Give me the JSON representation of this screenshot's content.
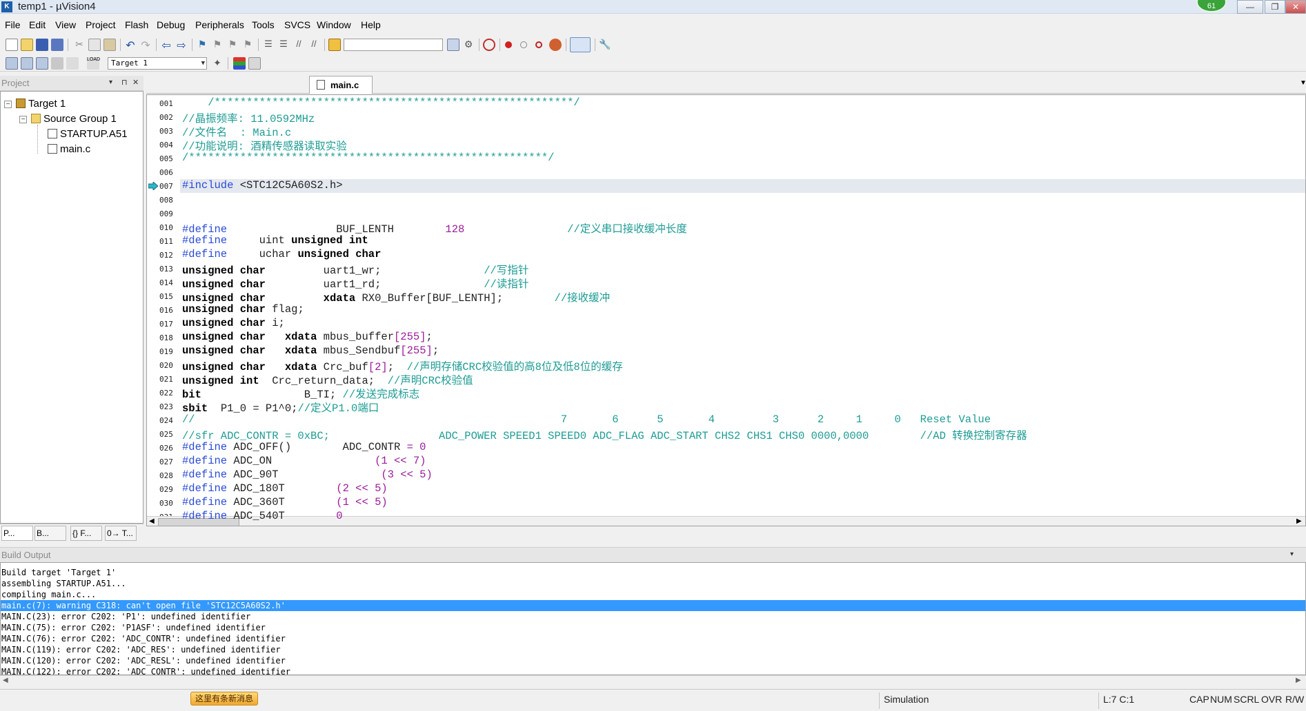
{
  "window": {
    "title": "temp1  - µVision4",
    "badge": "61",
    "controls": [
      "—",
      "❐",
      "✕"
    ]
  },
  "menu": [
    "File",
    "Edit",
    "View",
    "Project",
    "Flash",
    "Debug",
    "Peripherals",
    "Tools",
    "SVCS",
    "Window",
    "Help"
  ],
  "toolbar": {
    "target_combo": "Target 1",
    "find_combo": ""
  },
  "project_panel": {
    "title": "Project",
    "header_buttons": [
      "▾",
      "⊓",
      "✕"
    ],
    "tree": {
      "target": "Target 1",
      "group": "Source Group 1",
      "files": [
        "STARTUP.A51",
        "main.c"
      ]
    },
    "tabs": [
      "P...",
      "B...",
      "{} F...",
      "0→ T..."
    ]
  },
  "editor": {
    "tab": "main.c",
    "lines": [
      {
        "n": "001",
        "code": "    /********************************************************/"
      },
      {
        "n": "002",
        "code": "//晶振频率: 11.0592MHz"
      },
      {
        "n": "003",
        "code": "//文件名  : Main.c"
      },
      {
        "n": "004",
        "code": "//功能说明: 酒精传感器读取实验"
      },
      {
        "n": "005",
        "code": "/********************************************************/"
      },
      {
        "n": "006",
        "code": ""
      },
      {
        "n": "007",
        "code": "#include <STC12C5A60S2.h>"
      },
      {
        "n": "008",
        "code": ""
      },
      {
        "n": "009",
        "code": ""
      },
      {
        "n": "010",
        "code": "#define                 BUF_LENTH        128                //定义串口接收缓冲长度"
      },
      {
        "n": "011",
        "code": "#define     uint unsigned int"
      },
      {
        "n": "012",
        "code": "#define     uchar unsigned char"
      },
      {
        "n": "013",
        "code": "unsigned char         uart1_wr;                //写指针"
      },
      {
        "n": "014",
        "code": "unsigned char         uart1_rd;                //读指针"
      },
      {
        "n": "015",
        "code": "unsigned char         xdata RX0_Buffer[BUF_LENTH];        //接收缓冲"
      },
      {
        "n": "016",
        "code": "unsigned char flag;"
      },
      {
        "n": "017",
        "code": "unsigned char i;"
      },
      {
        "n": "018",
        "code": "unsigned char   xdata mbus_buffer[255];"
      },
      {
        "n": "019",
        "code": "unsigned char   xdata mbus_Sendbuf[255];"
      },
      {
        "n": "020",
        "code": "unsigned char   xdata Crc_buf[2];  //声明存储CRC校验值的高8位及低8位的缓存"
      },
      {
        "n": "021",
        "code": "unsigned int  Crc_return_data;  //声明CRC校验值"
      },
      {
        "n": "022",
        "code": "bit                B_TI; //发送完成标志"
      },
      {
        "n": "023",
        "code": "sbit  P1_0 = P1^0;//定义P1.0端口"
      },
      {
        "n": "024",
        "code": "//                                                         7       6      5       4         3      2     1     0   Reset Value"
      },
      {
        "n": "025",
        "code": "//sfr ADC_CONTR = 0xBC;                 ADC_POWER SPEED1 SPEED0 ADC_FLAG ADC_START CHS2 CHS1 CHS0 0000,0000        //AD 转换控制寄存器"
      },
      {
        "n": "026",
        "code": "#define ADC_OFF()        ADC_CONTR = 0"
      },
      {
        "n": "027",
        "code": "#define ADC_ON                (1 << 7)"
      },
      {
        "n": "028",
        "code": "#define ADC_90T                (3 << 5)"
      },
      {
        "n": "029",
        "code": "#define ADC_180T        (2 << 5)"
      },
      {
        "n": "030",
        "code": "#define ADC_360T        (1 << 5)"
      },
      {
        "n": "031",
        "code": "#define ADC_540T        0"
      }
    ]
  },
  "build_output": {
    "title": "Build Output",
    "lines": [
      "Build target 'Target 1'",
      "assembling STARTUP.A51...",
      "compiling main.c...",
      "main.c(7): warning C318: can't open file 'STC12C5A60S2.h'",
      "MAIN.C(23): error C202: 'P1': undefined identifier",
      "MAIN.C(75): error C202: 'P1ASF': undefined identifier",
      "MAIN.C(76): error C202: 'ADC_CONTR': undefined identifier",
      "MAIN.C(119): error C202: 'ADC_RES': undefined identifier",
      "MAIN.C(120): error C202: 'ADC_RESL': undefined identifier",
      "MAIN.C(122): error C202: 'ADC_CONTR': undefined identifier"
    ],
    "selected_index": 3
  },
  "status": {
    "notification": "这里有条新消息",
    "mode": "Simulation",
    "position": "L:7 C:1",
    "indicators": [
      "CAP",
      "NUM",
      "SCRL",
      "OVR",
      "R/W"
    ]
  },
  "colors": {
    "selection": "#3399ff",
    "comment": "#1e9c94",
    "preprocessor": "#2a4bd6",
    "number": "#9a1c9a"
  }
}
